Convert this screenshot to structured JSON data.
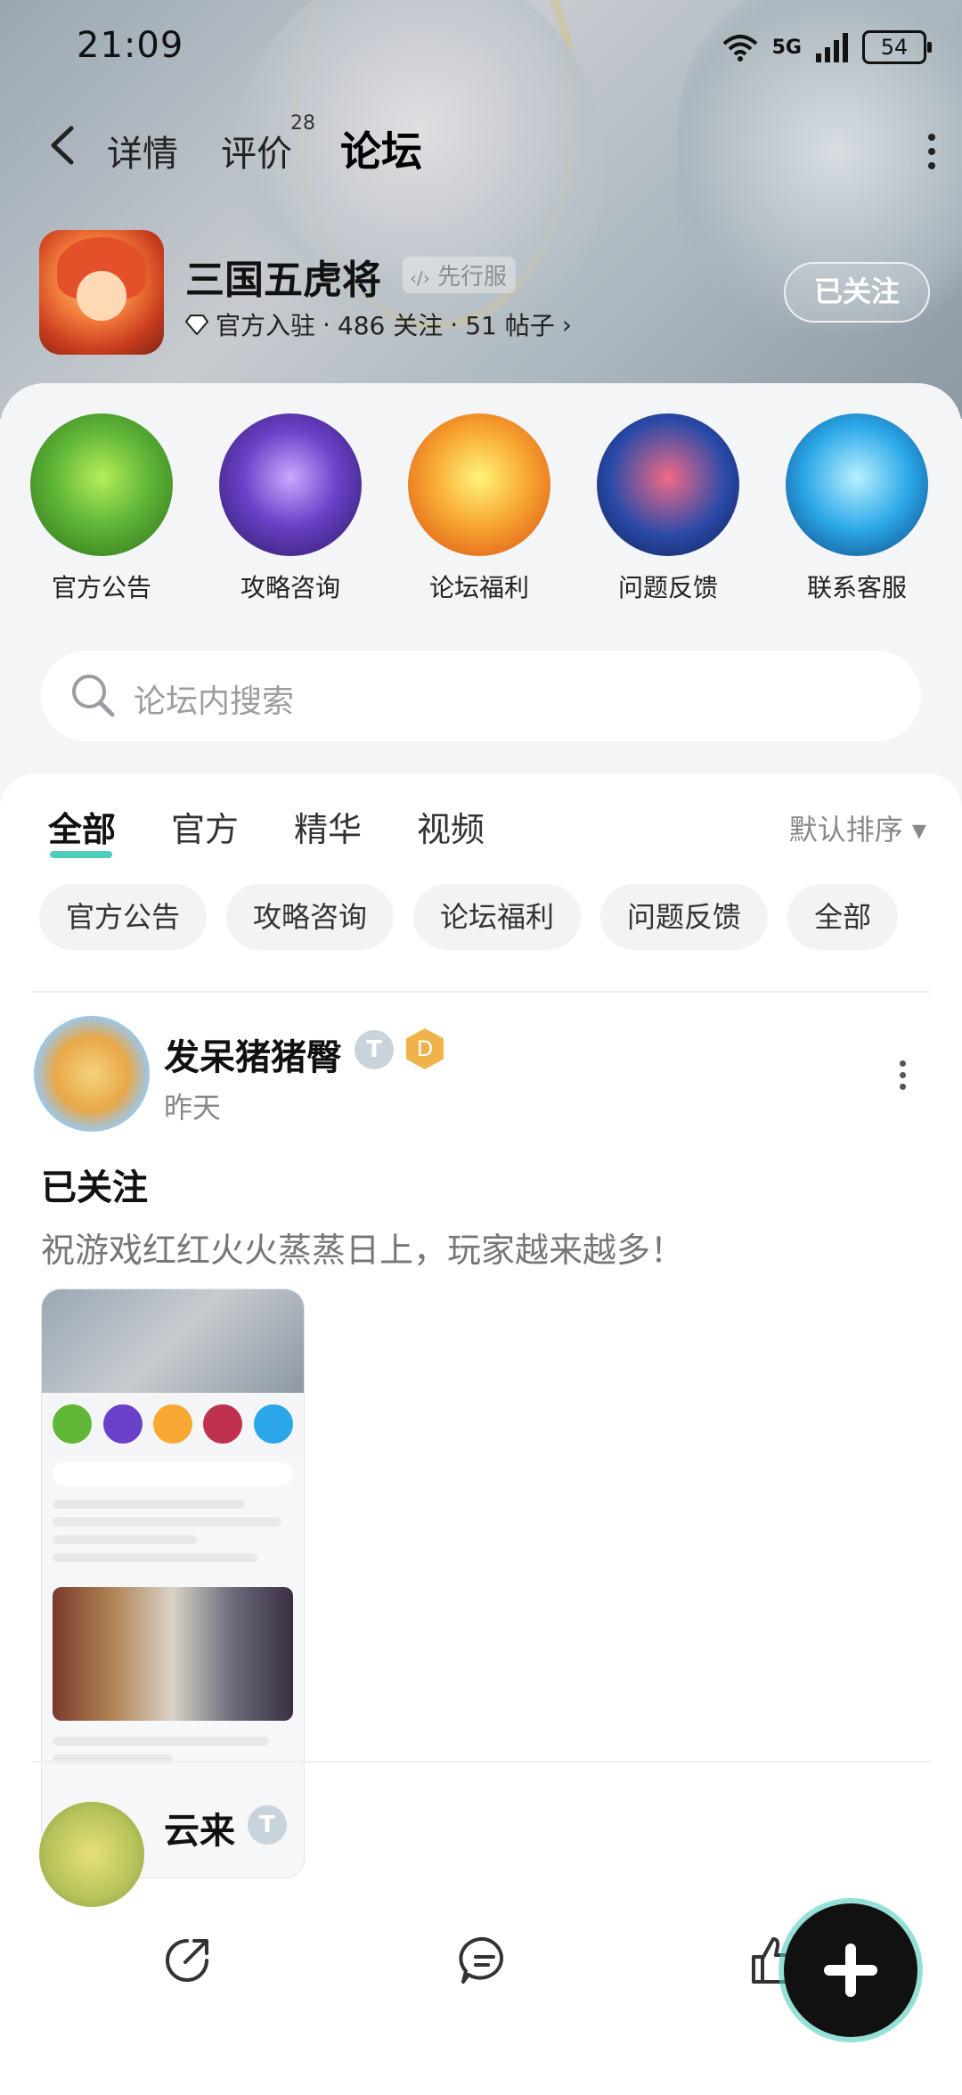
{
  "status_bar": {
    "time": "21:09",
    "network": "5G",
    "wifi_badge": "6",
    "battery": "54"
  },
  "top_nav": {
    "tabs": [
      {
        "label": "详情"
      },
      {
        "label": "评价",
        "badge": "28"
      },
      {
        "label": "论坛"
      }
    ]
  },
  "game": {
    "name": "三国五虎将",
    "tag": "先行服",
    "verified_label": "官方入驻",
    "followers": "486 关注",
    "posts": "51 帖子",
    "follow_button": "已关注"
  },
  "categories": [
    {
      "label": "官方公告",
      "color": "#5fb637"
    },
    {
      "label": "攻略咨询",
      "color": "#6a41c8"
    },
    {
      "label": "论坛福利",
      "color": "#f47a1f"
    },
    {
      "label": "问题反馈",
      "color": "#2a4aa8"
    },
    {
      "label": "联系客服",
      "color": "#2aa7e8"
    }
  ],
  "search": {
    "placeholder": "论坛内搜索"
  },
  "feed_tabs": [
    {
      "label": "全部"
    },
    {
      "label": "官方"
    },
    {
      "label": "精华"
    },
    {
      "label": "视频"
    }
  ],
  "sort": {
    "label": "默认排序 ▾"
  },
  "chips": [
    {
      "label": "官方公告"
    },
    {
      "label": "攻略咨询"
    },
    {
      "label": "论坛福利"
    },
    {
      "label": "问题反馈"
    },
    {
      "label": "全部"
    }
  ],
  "posts": [
    {
      "author": "发呆猪猪臀",
      "date": "昨天",
      "title": "已关注",
      "body": "祝游戏红红火火蒸蒸日上，玩家越来越多！"
    },
    {
      "author": "云来"
    }
  ],
  "accent_color": "#4ecdbd"
}
